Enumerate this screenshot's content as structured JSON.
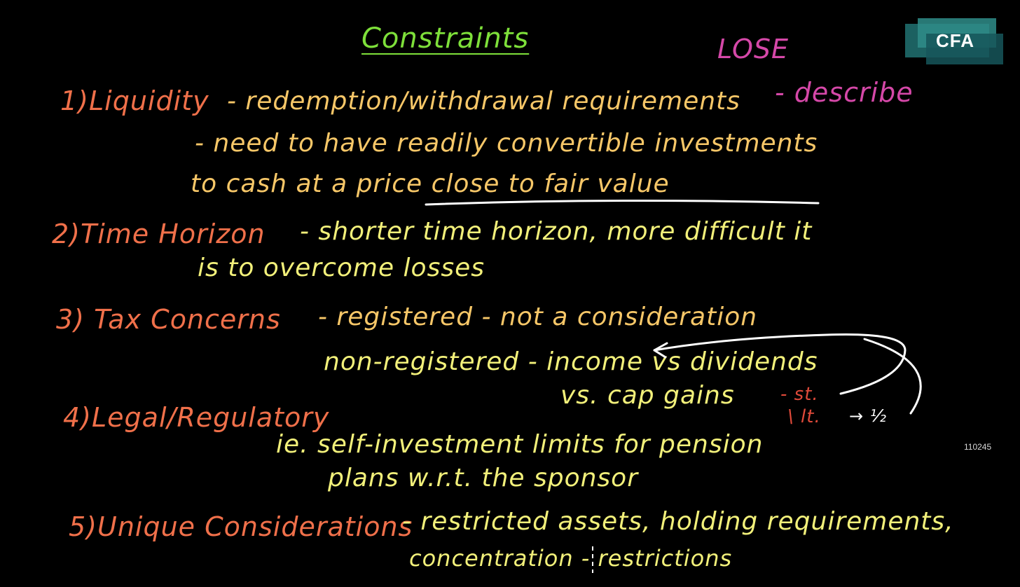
{
  "brand": {
    "logo_text": "CFA"
  },
  "video_id": "110245",
  "board": {
    "title": "Constraints",
    "margin_notes": {
      "lose": "LOSE",
      "describe": "- describe"
    },
    "items": [
      {
        "heading": "1)Liquidity",
        "lines": [
          "- redemption/withdrawal requirements",
          "- need to have readily convertible investments",
          "to cash at a price close to fair value"
        ]
      },
      {
        "heading": "2)Time Horizon",
        "lines": [
          "- shorter time horizon, more difficult it",
          "is to overcome losses"
        ]
      },
      {
        "heading": "3) Tax Concerns",
        "lines": [
          "- registered - not a consideration",
          "non-registered - income vs dividends",
          "vs. cap gains",
          "- st.",
          "\\ lt.",
          "→ ½"
        ]
      },
      {
        "heading": "4)Legal/Regulatory",
        "lines": [
          "ie. self-investment limits for pension",
          "plans w.r.t. the sponsor"
        ]
      },
      {
        "heading": "5)Unique Considerations",
        "lines": [
          "- restricted assets, holding requirements,",
          "concentration - restrictions"
        ]
      }
    ]
  },
  "colors": {
    "background": "#000000",
    "title": "#7ee03a",
    "heading": "#f0704a",
    "body": "#f7c768",
    "note": "#f2f07a",
    "pink": "#d548a8",
    "red": "#e04a3a"
  }
}
